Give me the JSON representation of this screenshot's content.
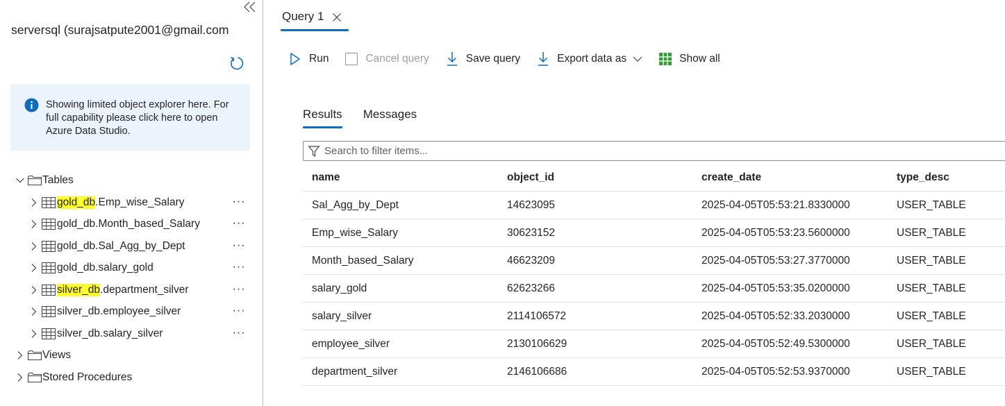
{
  "explorer": {
    "server": "serversql (surajsatpute2001@gmail.com",
    "info": "Showing limited object explorer here. For full capability please click here to open Azure Data Studio.",
    "tables_label": "Tables",
    "tables": [
      {
        "db": "gold_db",
        "name": ".Emp_wise_Salary",
        "highlight": true
      },
      {
        "db": "gold_db",
        "name": ".Month_based_Salary",
        "highlight": false
      },
      {
        "db": "gold_db",
        "name": ".Sal_Agg_by_Dept",
        "highlight": false
      },
      {
        "db": "gold_db",
        "name": ".salary_gold",
        "highlight": false
      },
      {
        "db": "silver_db",
        "name": ".department_silver",
        "highlight": true
      },
      {
        "db": "silver_db",
        "name": ".employee_silver",
        "highlight": false
      },
      {
        "db": "silver_db",
        "name": ".salary_silver",
        "highlight": false
      }
    ],
    "more": "···",
    "views_label": "Views",
    "procs_label": "Stored Procedures"
  },
  "query": {
    "tab_title": "Query 1",
    "toolbar": {
      "run": "Run",
      "cancel": "Cancel query",
      "save": "Save query",
      "export": "Export data as",
      "show_all": "Show all"
    },
    "result_tabs": {
      "results": "Results",
      "messages": "Messages"
    },
    "filter_placeholder": "Search to filter items...",
    "columns": [
      "name",
      "object_id",
      "create_date",
      "type_desc"
    ],
    "rows": [
      [
        "Sal_Agg_by_Dept",
        "14623095",
        "2025-04-05T05:53:21.8330000",
        "USER_TABLE"
      ],
      [
        "Emp_wise_Salary",
        "30623152",
        "2025-04-05T05:53:23.5600000",
        "USER_TABLE"
      ],
      [
        "Month_based_Salary",
        "46623209",
        "2025-04-05T05:53:27.3770000",
        "USER_TABLE"
      ],
      [
        "salary_gold",
        "62623266",
        "2025-04-05T05:53:35.0200000",
        "USER_TABLE"
      ],
      [
        "salary_silver",
        "2114106572",
        "2025-04-05T05:52:33.2030000",
        "USER_TABLE"
      ],
      [
        "employee_silver",
        "2130106629",
        "2025-04-05T05:52:49.5300000",
        "USER_TABLE"
      ],
      [
        "department_silver",
        "2146106686",
        "2025-04-05T05:52:53.9370000",
        "USER_TABLE"
      ]
    ]
  },
  "colors": {
    "accent": "#0f6cbd",
    "info_bg": "#ebf3fc",
    "highlight": "#ffff2e",
    "grid_icon": "#3a9b3a"
  }
}
